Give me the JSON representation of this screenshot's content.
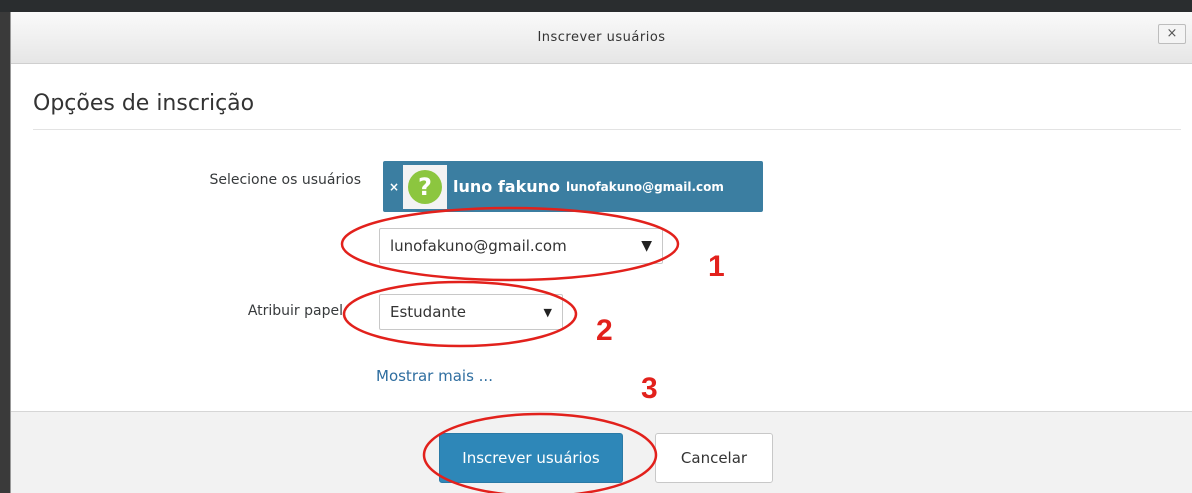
{
  "dialog": {
    "title": "Inscrever usuários",
    "close_label": "×"
  },
  "form": {
    "section_title": "Opções de inscrição",
    "users_label": "Selecione os usuários",
    "selected_user": {
      "remove_label": "×",
      "avatar_icon": "question-mark-avatar-icon",
      "name": "luno fakuno",
      "email": "lunofakuno@gmail.com"
    },
    "user_search_value": "lunofakuno@gmail.com",
    "role_label": "Atribuir papel",
    "role_value": "Estudante",
    "show_more_label": "Mostrar mais ..."
  },
  "footer": {
    "enroll_label": "Inscrever usuários",
    "cancel_label": "Cancelar"
  },
  "annotations": {
    "color": "#e2211c",
    "labels": [
      "1",
      "2",
      "3"
    ]
  },
  "colors": {
    "primary": "#2e87b8",
    "chip": "#3b7ea1",
    "link": "#2f6ea0"
  }
}
